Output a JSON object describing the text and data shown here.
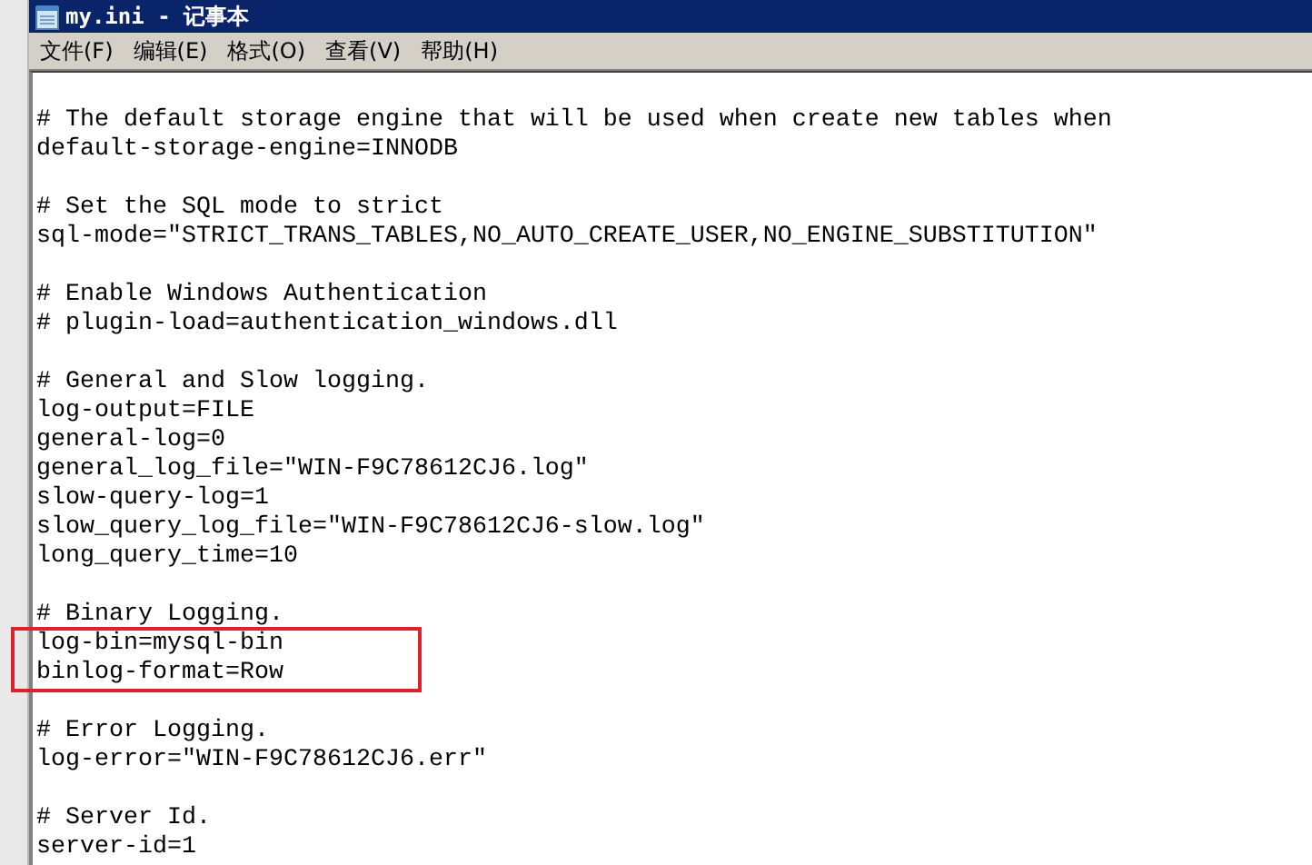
{
  "window": {
    "title": "my.ini - 记事本"
  },
  "menu": [
    "文件(F)",
    "编辑(E)",
    "格式(O)",
    "查看(V)",
    "帮助(H)"
  ],
  "lines": [
    {
      "kind": "blank"
    },
    {
      "kind": "text",
      "text": "# The default storage engine that will be used when create new tables when",
      "highlighted": false
    },
    {
      "kind": "text",
      "text": "default-storage-engine=INNODB",
      "highlighted": false
    },
    {
      "kind": "blank"
    },
    {
      "kind": "text",
      "text": "# Set the SQL mode to strict",
      "highlighted": false
    },
    {
      "kind": "text",
      "text": "sql-mode=\"STRICT_TRANS_TABLES,NO_AUTO_CREATE_USER,NO_ENGINE_SUBSTITUTION\"",
      "highlighted": false
    },
    {
      "kind": "blank"
    },
    {
      "kind": "text",
      "text": "# Enable Windows Authentication",
      "highlighted": false
    },
    {
      "kind": "text",
      "text": "# plugin-load=authentication_windows.dll",
      "highlighted": false
    },
    {
      "kind": "blank"
    },
    {
      "kind": "text",
      "text": "# General and Slow logging.",
      "highlighted": false
    },
    {
      "kind": "text",
      "text": "log-output=FILE",
      "highlighted": false
    },
    {
      "kind": "text",
      "text": "general-log=0",
      "highlighted": false
    },
    {
      "kind": "text",
      "text": "general_log_file=\"WIN-F9C78612CJ6.log\"",
      "highlighted": false
    },
    {
      "kind": "text",
      "text": "slow-query-log=1",
      "highlighted": false
    },
    {
      "kind": "text",
      "text": "slow_query_log_file=\"WIN-F9C78612CJ6-slow.log\"",
      "highlighted": false
    },
    {
      "kind": "text",
      "text": "long_query_time=10",
      "highlighted": false
    },
    {
      "kind": "blank"
    },
    {
      "kind": "text",
      "text": "# Binary Logging.",
      "highlighted": false
    },
    {
      "kind": "text",
      "text": "log-bin=mysql-bin",
      "highlighted": true
    },
    {
      "kind": "text",
      "text": "binlog-format=Row",
      "highlighted": true
    },
    {
      "kind": "blank"
    },
    {
      "kind": "text",
      "text": "# Error Logging.",
      "highlighted": false
    },
    {
      "kind": "text",
      "text": "log-error=\"WIN-F9C78612CJ6.err\"",
      "highlighted": false
    },
    {
      "kind": "blank"
    },
    {
      "kind": "text",
      "text": "# Server Id.",
      "highlighted": false
    },
    {
      "kind": "text",
      "text": "server-id=1",
      "highlighted": false
    }
  ]
}
